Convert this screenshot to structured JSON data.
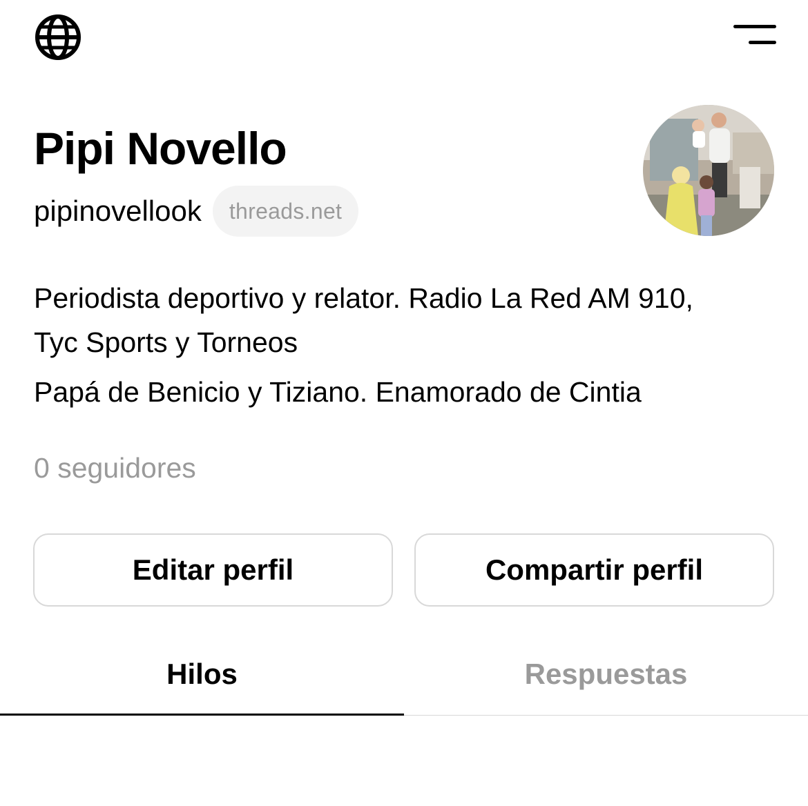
{
  "topbar": {
    "left_icon": "globe-icon",
    "right_icon": "menu-icon"
  },
  "profile": {
    "name": "Pipi Novello",
    "handle": "pipinovellook",
    "domain_badge": "threads.net",
    "bio_lines": [
      "Periodista deportivo y relator. Radio La Red AM 910,",
      "Tyc Sports y Torneos",
      "Papá de Benicio y Tiziano. Enamorado de Cintia"
    ],
    "followers": "0 seguidores"
  },
  "actions": {
    "edit_label": "Editar perfil",
    "share_label": "Compartir perfil"
  },
  "tabs": [
    {
      "label": "Hilos",
      "active": true
    },
    {
      "label": "Respuestas",
      "active": false
    }
  ],
  "colors": {
    "text": "#000000",
    "muted": "#9a9a9a",
    "border": "#d8d8d8",
    "pill_bg": "#f3f3f3"
  }
}
